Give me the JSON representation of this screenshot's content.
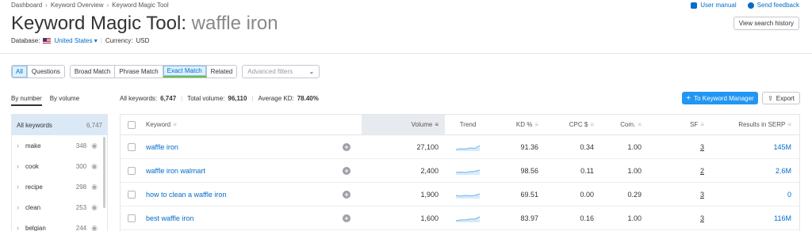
{
  "breadcrumb": [
    "Dashboard",
    "Keyword Overview",
    "Keyword Magic Tool"
  ],
  "top_links": {
    "manual": "User manual",
    "feedback": "Send feedback"
  },
  "page": {
    "title_prefix": "Keyword Magic Tool:",
    "title_keyword": "waffle iron",
    "database_label": "Database:",
    "database_value": "United States",
    "currency_label": "Currency:",
    "currency_value": "USD",
    "view_history": "View search history"
  },
  "filters": {
    "group1": [
      "All",
      "Questions"
    ],
    "group2": [
      "Broad Match",
      "Phrase Match",
      "Exact Match",
      "Related"
    ],
    "advanced_placeholder": "Advanced filters"
  },
  "sort_tabs": {
    "by_number": "By number",
    "by_volume": "By volume"
  },
  "summary": {
    "all_keywords_label": "All keywords:",
    "all_keywords_value": "6,747",
    "total_volume_label": "Total volume:",
    "total_volume_value": "96,110",
    "avg_kd_label": "Average KD:",
    "avg_kd_value": "78.40%"
  },
  "actions": {
    "to_km": "To Keyword Manager",
    "export": "Export"
  },
  "sidebar": {
    "items": [
      {
        "label": "All keywords",
        "count": "6,747"
      },
      {
        "label": "make",
        "count": "348"
      },
      {
        "label": "cook",
        "count": "300"
      },
      {
        "label": "recipe",
        "count": "298"
      },
      {
        "label": "clean",
        "count": "253"
      },
      {
        "label": "belgian",
        "count": "244"
      }
    ]
  },
  "table": {
    "headers": {
      "keyword": "Keyword",
      "volume": "Volume",
      "trend": "Trend",
      "kd": "KD %",
      "cpc": "CPC $",
      "com": "Com.",
      "sf": "SF",
      "serp": "Results in SERP"
    },
    "rows": [
      {
        "keyword": "waffle iron",
        "volume": "27,100",
        "kd": "91.36",
        "cpc": "0.34",
        "com": "1.00",
        "sf": "3",
        "serp": "145M"
      },
      {
        "keyword": "waffle iron walmart",
        "volume": "2,400",
        "kd": "98.56",
        "cpc": "0.11",
        "com": "1.00",
        "sf": "2",
        "serp": "2.6M"
      },
      {
        "keyword": "how to clean a waffle iron",
        "volume": "1,900",
        "kd": "69.51",
        "cpc": "0.00",
        "com": "0.29",
        "sf": "3",
        "serp": "0"
      },
      {
        "keyword": "best waffle iron",
        "volume": "1,600",
        "kd": "83.97",
        "cpc": "0.16",
        "com": "1.00",
        "sf": "3",
        "serp": "116M"
      }
    ]
  },
  "colors": {
    "accent": "#006dca",
    "primary_button": "#2196f3",
    "active_filter_underline": "#6cbf4a"
  }
}
